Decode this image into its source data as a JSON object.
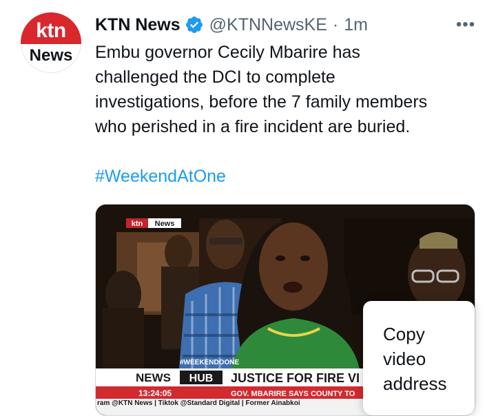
{
  "tweet": {
    "avatar": {
      "icon": "ktn-news-logo",
      "line1": "ktn",
      "line2": "News",
      "brand_red": "#d9272e"
    },
    "display_name": "KTN News",
    "verified_icon": "verified-badge-icon",
    "handle": "@KTNNewsKE",
    "separator": "·",
    "time": "1m",
    "more_icon": "more-options-icon",
    "more_glyph": "•••",
    "text": "Embu governor Cecily Mbarire has\nchallenged the DCI to complete\ninvestigations, before the 7 family members\nwho perished in a fire incident are buried.",
    "hashtag": "#WeekendAtOne",
    "link_color": "#1d9bf0"
  },
  "video": {
    "logo_ktn": "ktn",
    "logo_news": "News",
    "show_tag": "#WEEKENDOONE",
    "bar_news": "NEWS",
    "bar_hub": "HUB",
    "headline": "JUSTICE FOR FIRE VI",
    "clock": "13:24:05",
    "subheadline": "GOV. MBARIRE SAYS COUNTY TO",
    "ticker": "ram @KTN News | Tiktok @Standard Digital | Former Ainabkoi"
  },
  "context_menu": {
    "item": "Copy\nvideo\naddress"
  }
}
